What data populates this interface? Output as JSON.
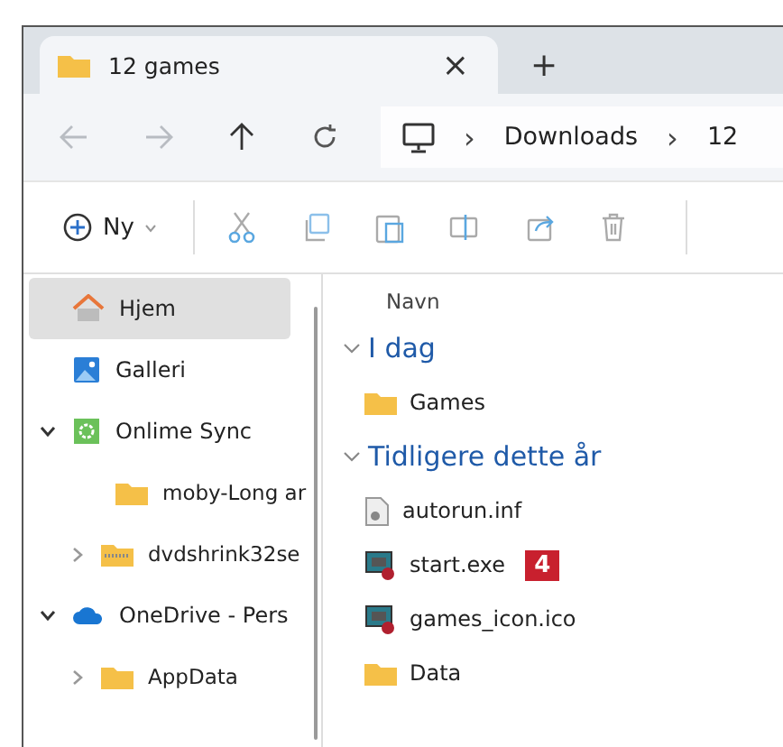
{
  "tabs": [
    {
      "title": "12 games",
      "selected": true,
      "close": "×"
    }
  ],
  "new_tab": "+",
  "address": {
    "segments": [
      "Downloads",
      "12"
    ],
    "separator": "›"
  },
  "toolbar": {
    "new_label": "Ny"
  },
  "sidebar": {
    "items": [
      {
        "label": "Hjem",
        "kind": "home",
        "selected": true
      },
      {
        "label": "Galleri",
        "kind": "gallery",
        "selected": false
      },
      {
        "label": "Onlime Sync",
        "kind": "sync",
        "selected": false,
        "expanded": true,
        "children": [
          {
            "label": "moby-Long ar",
            "kind": "folder",
            "selected": false
          },
          {
            "label": "dvdshrink32se",
            "kind": "zip",
            "selected": false,
            "expanded": false
          }
        ]
      },
      {
        "label": "OneDrive - Pers",
        "kind": "cloud",
        "selected": false,
        "expanded": true,
        "children": [
          {
            "label": "AppData",
            "kind": "folder",
            "selected": false,
            "expanded": false
          }
        ]
      }
    ]
  },
  "content": {
    "column": "Navn",
    "groups": [
      {
        "title": "I dag",
        "expanded": true,
        "files": [
          {
            "name": "Games",
            "kind": "folder"
          }
        ]
      },
      {
        "title": "Tidligere dette år",
        "expanded": true,
        "files": [
          {
            "name": "autorun.inf",
            "kind": "file"
          },
          {
            "name": "start.exe",
            "kind": "game",
            "badge": "4"
          },
          {
            "name": "games_icon.ico",
            "kind": "game"
          },
          {
            "name": "Data",
            "kind": "folder"
          }
        ]
      }
    ]
  }
}
